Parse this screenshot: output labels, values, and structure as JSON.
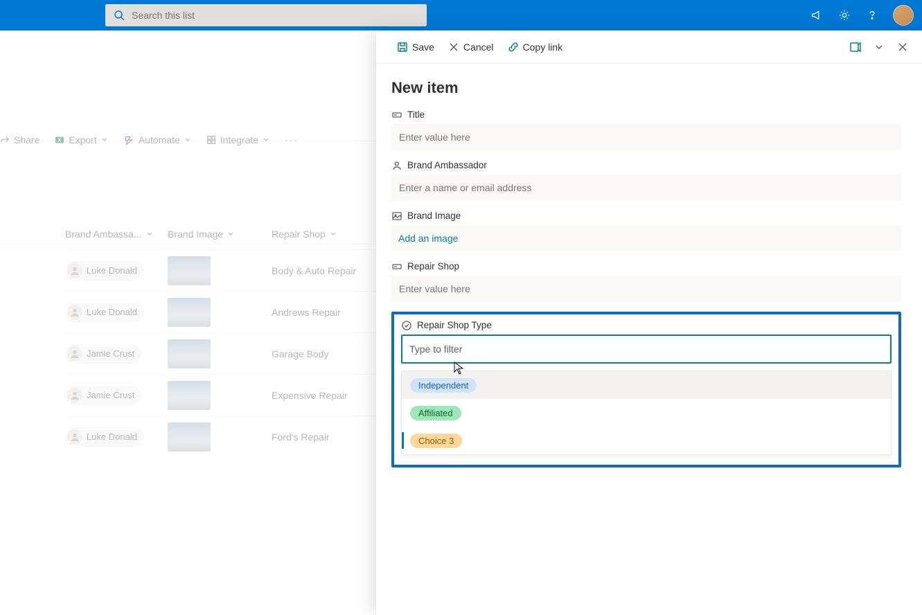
{
  "topbar": {
    "search_placeholder": "Search this list"
  },
  "commandbar": {
    "share": "Share",
    "export": "Export",
    "automate": "Automate",
    "integrate": "Integrate"
  },
  "columns": {
    "brand_ambassador": "Brand Ambassa...",
    "brand_image": "Brand Image",
    "repair_shop": "Repair Shop"
  },
  "rows": [
    {
      "person": "Luke Donald",
      "repair": "Body & Auto Repair"
    },
    {
      "person": "Luke Donald",
      "repair": "Andrews Repair"
    },
    {
      "person": "Jamie Crust",
      "repair": "Garage Body"
    },
    {
      "person": "Jamie Crust",
      "repair": "Expensive Repair"
    },
    {
      "person": "Luke Donald",
      "repair": "Ford's Repair"
    }
  ],
  "panel": {
    "save": "Save",
    "cancel": "Cancel",
    "copylink": "Copy link",
    "title": "New item",
    "fields": {
      "title_label": "Title",
      "title_placeholder": "Enter value here",
      "ambassador_label": "Brand Ambassador",
      "ambassador_placeholder": "Enter a name or email address",
      "image_label": "Brand Image",
      "image_action": "Add an image",
      "repairshop_label": "Repair Shop",
      "repairshop_placeholder": "Enter value here",
      "repairshoptype_label": "Repair Shop Type",
      "filter_placeholder": "Type to filter"
    },
    "choices": {
      "independent": "Independent",
      "affiliated": "Affiliated",
      "choice3": "Choice 3"
    }
  }
}
